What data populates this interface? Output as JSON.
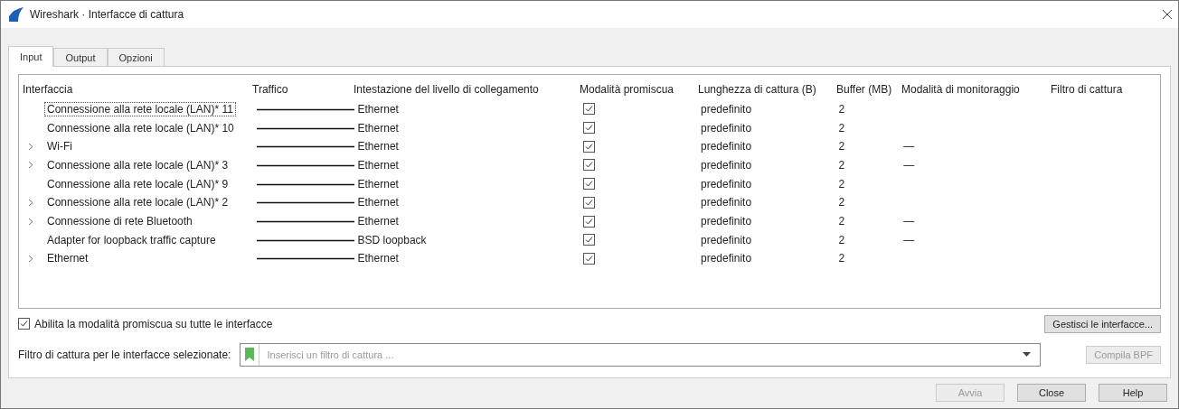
{
  "window": {
    "title": "Wireshark · Interfacce di cattura"
  },
  "tabs": [
    {
      "label": "Input",
      "selected": true
    },
    {
      "label": "Output",
      "selected": false
    },
    {
      "label": "Opzioni",
      "selected": false
    }
  ],
  "table": {
    "columns": [
      "Interfaccia",
      "Traffico",
      "Intestazione del livello di collegamento",
      "Modalità promiscua",
      "Lunghezza di cattura (B)",
      "Buffer (MB)",
      "Modalità di monitoraggio",
      "Filtro di cattura"
    ],
    "rows": [
      {
        "interface": "Connessione alla rete locale (LAN)* 11",
        "expandable": false,
        "selected": true,
        "link_layer": "Ethernet",
        "promiscuous": true,
        "snaplen": "predefinito",
        "buffer": "2"
      },
      {
        "interface": "Connessione alla rete locale (LAN)* 10",
        "expandable": false,
        "selected": false,
        "link_layer": "Ethernet",
        "promiscuous": true,
        "snaplen": "predefinito",
        "buffer": "2"
      },
      {
        "interface": "Wi-Fi",
        "expandable": true,
        "selected": false,
        "link_layer": "Ethernet",
        "promiscuous": true,
        "snaplen": "predefinito",
        "buffer": "2",
        "monitor": "—"
      },
      {
        "interface": "Connessione alla rete locale (LAN)* 3",
        "expandable": true,
        "selected": false,
        "link_layer": "Ethernet",
        "promiscuous": true,
        "snaplen": "predefinito",
        "buffer": "2",
        "monitor": "—"
      },
      {
        "interface": "Connessione alla rete locale (LAN)* 9",
        "expandable": false,
        "selected": false,
        "link_layer": "Ethernet",
        "promiscuous": true,
        "snaplen": "predefinito",
        "buffer": "2"
      },
      {
        "interface": "Connessione alla rete locale (LAN)* 2",
        "expandable": true,
        "selected": false,
        "link_layer": "Ethernet",
        "promiscuous": true,
        "snaplen": "predefinito",
        "buffer": "2"
      },
      {
        "interface": "Connessione di rete Bluetooth",
        "expandable": true,
        "selected": false,
        "link_layer": "Ethernet",
        "promiscuous": true,
        "snaplen": "predefinito",
        "buffer": "2",
        "monitor": "—"
      },
      {
        "interface": "Adapter for loopback traffic capture",
        "expandable": false,
        "selected": false,
        "link_layer": "BSD loopback",
        "promiscuous": true,
        "snaplen": "predefinito",
        "buffer": "2",
        "monitor": "—"
      },
      {
        "interface": "Ethernet",
        "expandable": true,
        "selected": false,
        "link_layer": "Ethernet",
        "promiscuous": true,
        "snaplen": "predefinito",
        "buffer": "2"
      }
    ]
  },
  "promisc_all": {
    "label": "Abilita la modalità promiscua su tutte le interfacce",
    "checked": true
  },
  "manage_button": "Gestisci le interfacce...",
  "filter": {
    "label": "Filtro di cattura per le interfacce selezionate:",
    "placeholder": "Inserisci un filtro di cattura ..."
  },
  "compile_button": {
    "label": "Compila BPF",
    "disabled": true
  },
  "buttons": [
    {
      "label": "Avvia",
      "disabled": true
    },
    {
      "label": "Close",
      "disabled": false
    },
    {
      "label": "Help",
      "disabled": false
    }
  ]
}
